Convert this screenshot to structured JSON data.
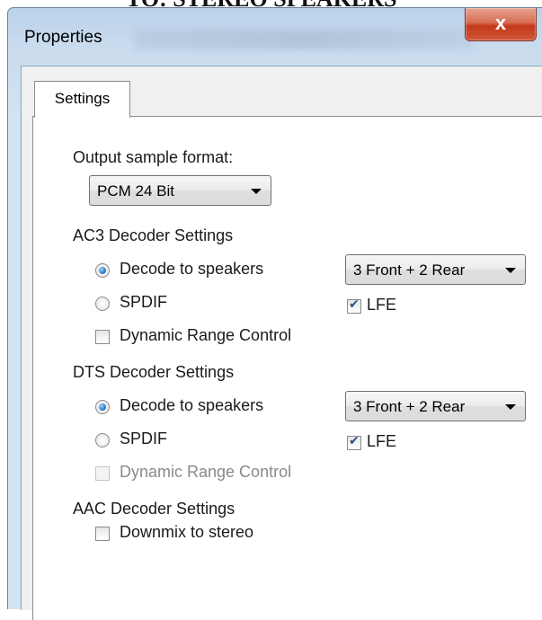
{
  "background_caption": "TO: STEREO SPEAKERS",
  "window": {
    "title": "Properties",
    "close_glyph": "x"
  },
  "tabs": [
    {
      "label": "Settings",
      "selected": true
    }
  ],
  "output": {
    "label": "Output sample format:",
    "selected": "PCM 24 Bit"
  },
  "ac3": {
    "heading": "AC3 Decoder Settings",
    "decode_label": "Decode to speakers",
    "decode_selected": true,
    "speakers_selected": "3 Front + 2 Rear",
    "spdif_label": "SPDIF",
    "spdif_selected": false,
    "lfe_label": "LFE",
    "lfe_checked": true,
    "drc_label": "Dynamic Range Control",
    "drc_checked": false,
    "drc_enabled": true
  },
  "dts": {
    "heading": "DTS Decoder Settings",
    "decode_label": "Decode to speakers",
    "decode_selected": true,
    "speakers_selected": "3 Front + 2 Rear",
    "spdif_label": "SPDIF",
    "spdif_selected": false,
    "lfe_label": "LFE",
    "lfe_checked": true,
    "drc_label": "Dynamic Range Control",
    "drc_checked": false,
    "drc_enabled": false
  },
  "aac": {
    "heading": "AAC Decoder Settings",
    "downmix_label": "Downmix to stereo",
    "downmix_checked": false
  }
}
